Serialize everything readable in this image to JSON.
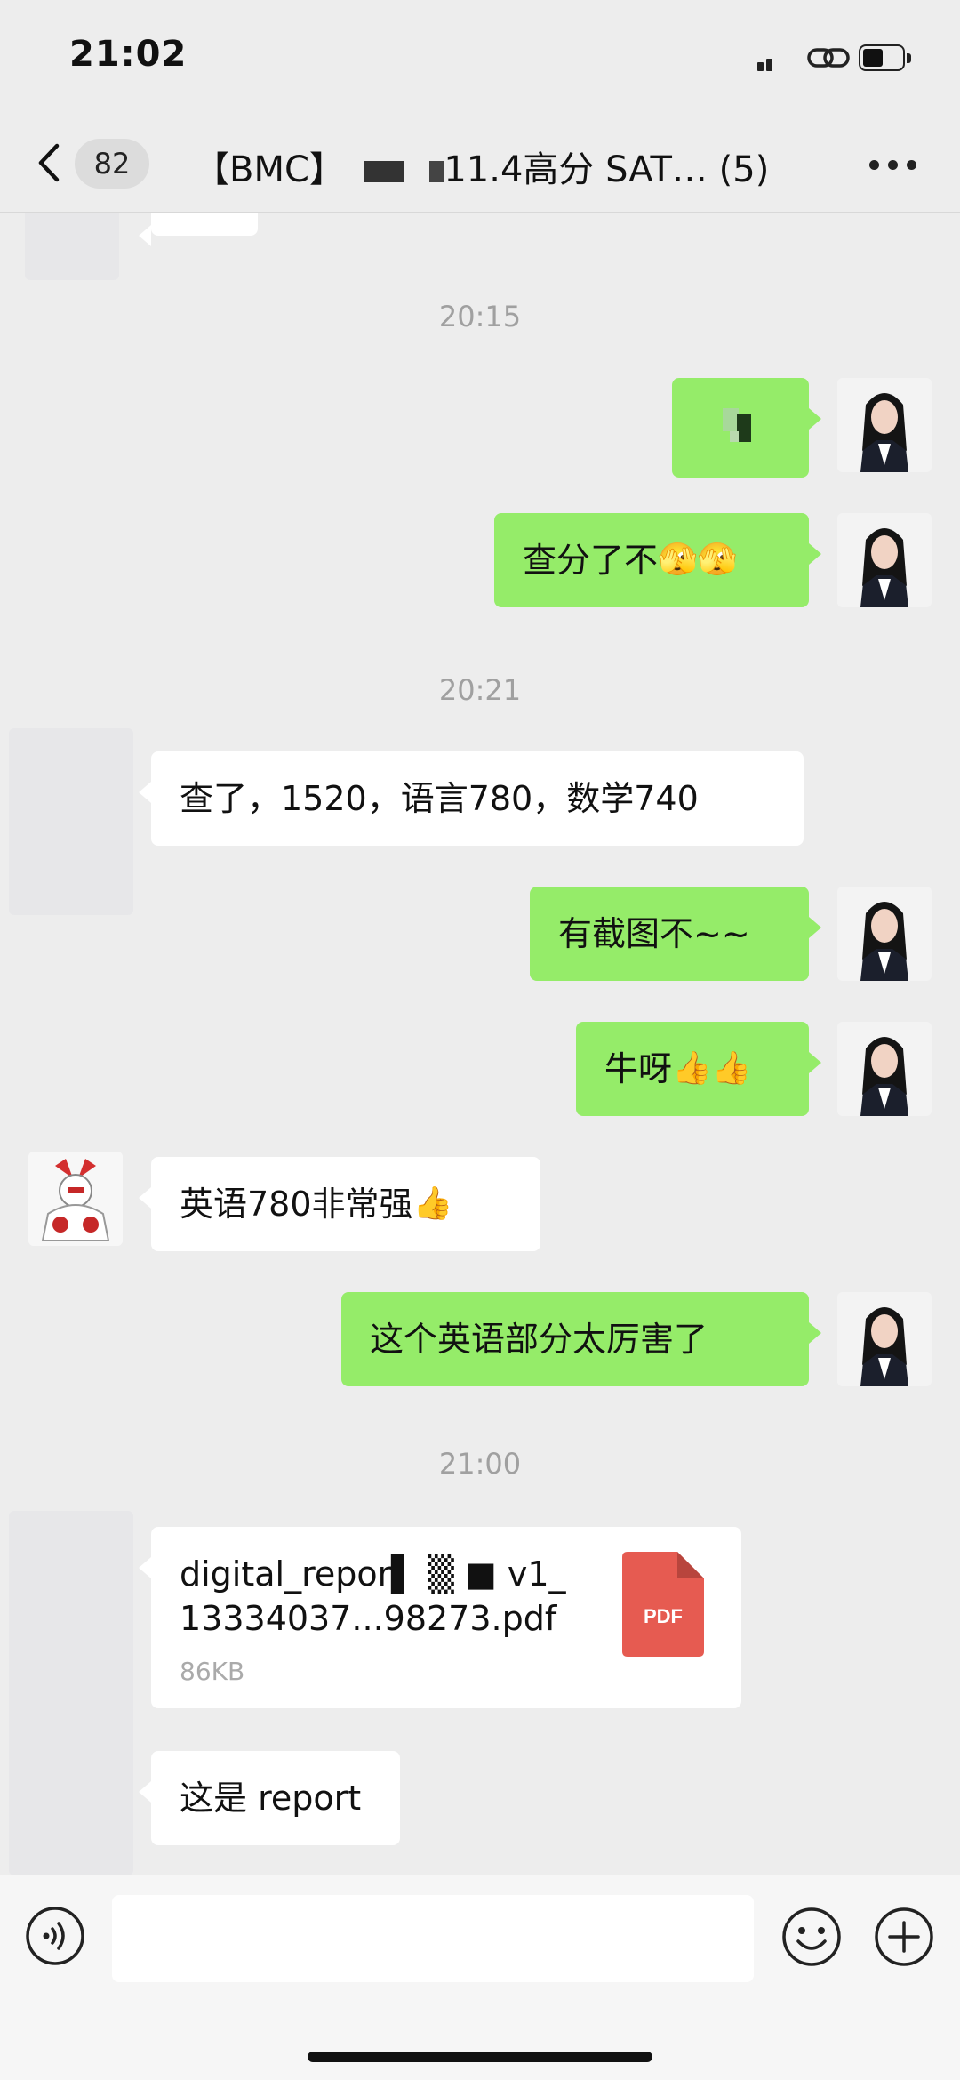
{
  "status_bar": {
    "time": "21:02"
  },
  "header": {
    "back_label": "back",
    "unread_count": "82",
    "title_prefix": "【BMC】",
    "title_suffix": "11.4高分 SAT…",
    "member_count": "(5)"
  },
  "messages": [
    {
      "type": "time",
      "text": "20:15"
    },
    {
      "type": "text",
      "side": "right",
      "text": ""
    },
    {
      "type": "text",
      "side": "right",
      "text": "查分了不",
      "emoji": "🫣🫣"
    },
    {
      "type": "time",
      "text": "20:21"
    },
    {
      "type": "text",
      "side": "left",
      "text": "查了，1520，语言780，数学740"
    },
    {
      "type": "text",
      "side": "right",
      "text": "有截图不~~"
    },
    {
      "type": "text",
      "side": "right",
      "text": "牛呀",
      "emoji": "👍👍"
    },
    {
      "type": "text",
      "side": "left",
      "text": "英语780非常强",
      "emoji": "👍"
    },
    {
      "type": "text",
      "side": "right",
      "text": "这个英语部分太厉害了"
    },
    {
      "type": "time",
      "text": "21:00"
    },
    {
      "type": "file",
      "side": "left",
      "file_name": "digital_repor▌ ▒ ■ v1_ 13334037...98273.pdf",
      "file_size": "86KB",
      "file_type": "PDF"
    },
    {
      "type": "text",
      "side": "left",
      "text": "这是 report"
    }
  ],
  "input_bar": {
    "placeholder": ""
  },
  "colors": {
    "background": "#ededed",
    "self_bubble": "#95ec69",
    "other_bubble": "#ffffff",
    "pdf_icon": "#e65b51"
  }
}
